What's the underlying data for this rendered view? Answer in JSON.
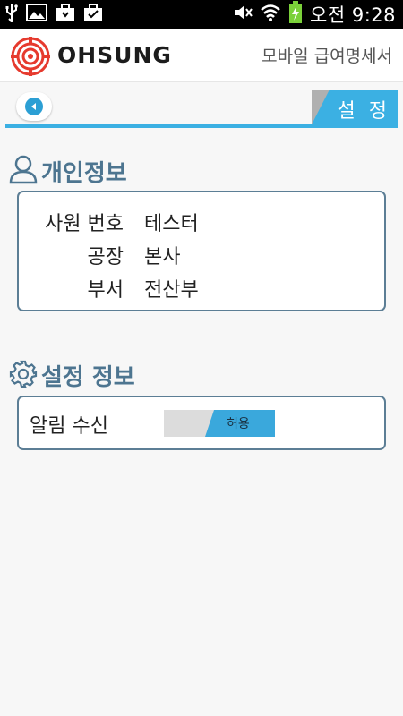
{
  "status_bar": {
    "time": "오전 9:28",
    "icons": [
      "usb-icon",
      "image-icon",
      "bag-icon",
      "bag-check-icon",
      "mute-icon",
      "wifi-icon",
      "battery-charging-icon"
    ]
  },
  "header": {
    "brand": "OHSUNG",
    "title": "모바일 급여명세서",
    "logo_color": "#e63a2e"
  },
  "nav": {
    "settings_label": "설 정",
    "accent": "#3bb0e3"
  },
  "personal": {
    "title": "개인정보",
    "rows": [
      {
        "label": "사원 번호",
        "value": "테스터"
      },
      {
        "label": "공장",
        "value": "본사"
      },
      {
        "label": "부서",
        "value": "전산부"
      }
    ]
  },
  "settings_info": {
    "title": "설정 정보",
    "notification_label": "알림 수신",
    "toggle_value": "허용"
  }
}
